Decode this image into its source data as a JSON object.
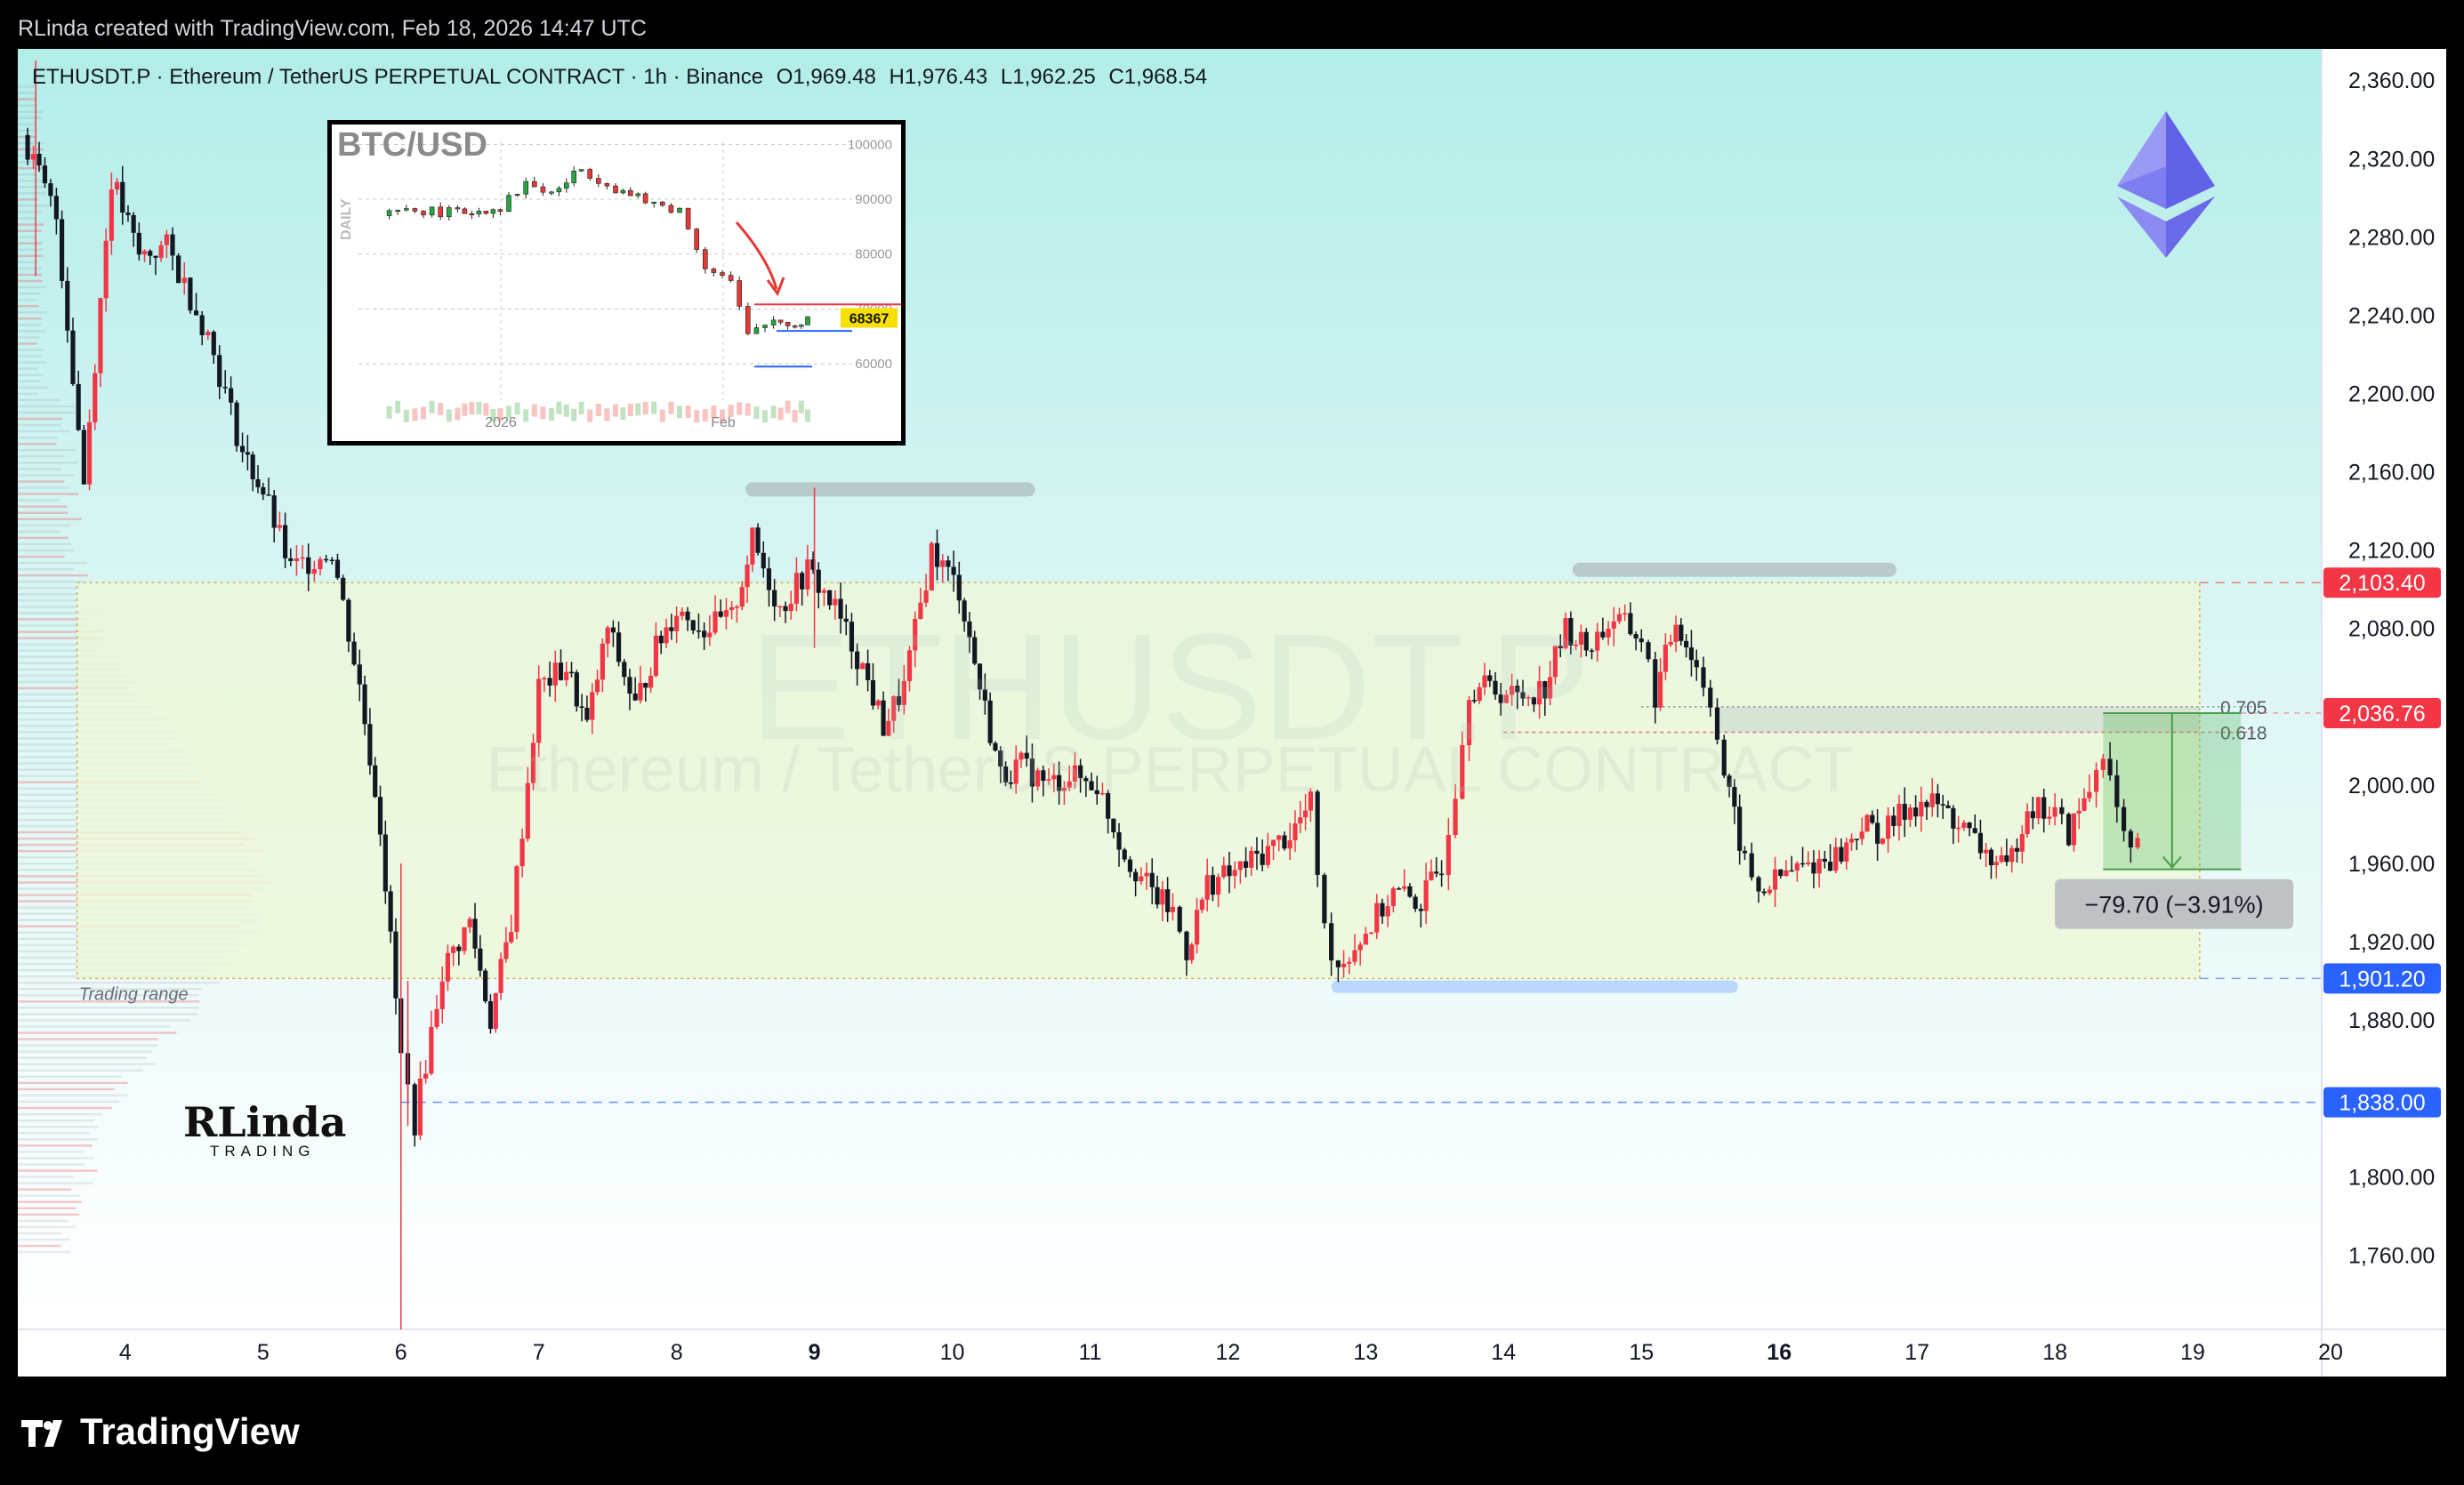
{
  "header": {
    "credit": "RLinda created with TradingView.com, Feb 18, 2026 14:47 UTC"
  },
  "legend": {
    "symbol": "ETHUSDT.P · Ethereum / TetherUS PERPETUAL CONTRACT · 1h · Binance",
    "open": "O1,969.48",
    "high": "H1,976.43",
    "low": "L1,962.25",
    "close": "C1,968.54"
  },
  "watermark": {
    "symbol": "ETHUSDT.P",
    "description": "Ethereum / TetherUS PERPETUAL CONTRACT"
  },
  "footer": {
    "brand": "TradingView"
  },
  "annotations": {
    "trading_range_label": "Trading range",
    "measure_label": "−79.70 (−3.91%)",
    "fib_705": "0.705",
    "fib_618": "0.618",
    "author_logo": "RLinda",
    "author_logo_sub": "TRADING"
  },
  "price_tags": [
    {
      "value": 2103.4,
      "label": "2,103.40",
      "color": "#f23645"
    },
    {
      "value": 2036.76,
      "label": "2,036.76",
      "color": "#f23645"
    },
    {
      "value": 1901.2,
      "label": "1,901.20",
      "color": "#2962ff"
    },
    {
      "value": 1838.0,
      "label": "1,838.00",
      "color": "#2962ff"
    }
  ],
  "colors": {
    "up": "#f23645",
    "down": "#131722",
    "accent_blue": "#2962ff",
    "range_fill": "#eef8d8",
    "target_fill": "#4caf50"
  },
  "chart_data": [
    {
      "type": "candlestick",
      "title": "",
      "x_ticks": [
        {
          "day": 4,
          "label": "4",
          "bold": false
        },
        {
          "day": 5,
          "label": "5",
          "bold": false
        },
        {
          "day": 6,
          "label": "6",
          "bold": false
        },
        {
          "day": 7,
          "label": "7",
          "bold": false
        },
        {
          "day": 8,
          "label": "8",
          "bold": false
        },
        {
          "day": 9,
          "label": "9",
          "bold": true
        },
        {
          "day": 10,
          "label": "10",
          "bold": false
        },
        {
          "day": 11,
          "label": "11",
          "bold": false
        },
        {
          "day": 12,
          "label": "12",
          "bold": false
        },
        {
          "day": 13,
          "label": "13",
          "bold": false
        },
        {
          "day": 14,
          "label": "14",
          "bold": false
        },
        {
          "day": 15,
          "label": "15",
          "bold": false
        },
        {
          "day": 16,
          "label": "16",
          "bold": true
        },
        {
          "day": 17,
          "label": "17",
          "bold": false
        },
        {
          "day": 18,
          "label": "18",
          "bold": false
        },
        {
          "day": 19,
          "label": "19",
          "bold": false
        },
        {
          "day": 20,
          "label": "20",
          "bold": false
        }
      ],
      "y_ticks": [
        2360,
        2320,
        2280,
        2240,
        2200,
        2160,
        2120,
        2080,
        2040,
        2000,
        1960,
        1920,
        1880,
        1840,
        1800,
        1760
      ],
      "y_tick_labels": [
        "2,360.00",
        "2,320.00",
        "2,280.00",
        "2,240.00",
        "2,200.00",
        "2,160.00",
        "2,120.00",
        "2,080.00",
        "2,040.00",
        "2,000.00",
        "1,960.00",
        "1,920.00",
        "1,880.00",
        "1,840.00",
        "1,800.00",
        "1,760.00"
      ],
      "ylim": [
        1722,
        2376
      ],
      "xlim": [
        3.22,
        20.0
      ],
      "trading_range": {
        "x_start": 3.65,
        "x_end": 19.05,
        "y_low": 1901.2,
        "y_high": 2103.4
      },
      "fib_zone": {
        "x_start": 15.55,
        "x_end": 19.05,
        "y_low": 2027,
        "y_high": 2040
      },
      "target_box": {
        "x_start": 18.35,
        "x_end": 19.35,
        "y_high": 2036.76,
        "y_low": 1957
      },
      "support_1838": {
        "x_start": 6.0,
        "x_end": 19.05,
        "y": 1838
      },
      "resistance_marks": [
        {
          "x_start": 8.5,
          "x_end": 10.6,
          "y": 2151
        },
        {
          "x_start": 14.5,
          "x_end": 16.85,
          "y": 2110
        }
      ],
      "support_mark": {
        "x_start": 12.75,
        "x_end": 15.7,
        "y": 1897
      },
      "key_points": [
        {
          "x": 3.25,
          "y": 2332
        },
        {
          "x": 3.5,
          "y": 2290
        },
        {
          "x": 3.7,
          "y": 2155
        },
        {
          "x": 3.9,
          "y": 2310
        },
        {
          "x": 4.1,
          "y": 2270
        },
        {
          "x": 4.3,
          "y": 2275
        },
        {
          "x": 4.6,
          "y": 2230
        },
        {
          "x": 4.85,
          "y": 2170
        },
        {
          "x": 5.0,
          "y": 2150
        },
        {
          "x": 5.2,
          "y": 2110
        },
        {
          "x": 5.5,
          "y": 2120
        },
        {
          "x": 5.7,
          "y": 2050
        },
        {
          "x": 5.85,
          "y": 1980
        },
        {
          "x": 6.0,
          "y": 1860
        },
        {
          "x": 6.1,
          "y": 1828
        },
        {
          "x": 6.3,
          "y": 1905
        },
        {
          "x": 6.5,
          "y": 1930
        },
        {
          "x": 6.65,
          "y": 1880
        },
        {
          "x": 6.8,
          "y": 1930
        },
        {
          "x": 7.0,
          "y": 2050
        },
        {
          "x": 7.2,
          "y": 2060
        },
        {
          "x": 7.35,
          "y": 2030
        },
        {
          "x": 7.5,
          "y": 2080
        },
        {
          "x": 7.7,
          "y": 2040
        },
        {
          "x": 7.85,
          "y": 2070
        },
        {
          "x": 8.0,
          "y": 2090
        },
        {
          "x": 8.2,
          "y": 2080
        },
        {
          "x": 8.4,
          "y": 2085
        },
        {
          "x": 8.55,
          "y": 2125
        },
        {
          "x": 8.75,
          "y": 2090
        },
        {
          "x": 8.95,
          "y": 2110
        },
        {
          "x": 9.15,
          "y": 2090
        },
        {
          "x": 9.35,
          "y": 2060
        },
        {
          "x": 9.5,
          "y": 2030
        },
        {
          "x": 9.65,
          "y": 2050
        },
        {
          "x": 9.85,
          "y": 2120
        },
        {
          "x": 10.05,
          "y": 2100
        },
        {
          "x": 10.2,
          "y": 2050
        },
        {
          "x": 10.35,
          "y": 2005
        },
        {
          "x": 10.5,
          "y": 2010
        },
        {
          "x": 10.7,
          "y": 2000
        },
        {
          "x": 10.85,
          "y": 2005
        },
        {
          "x": 11.05,
          "y": 2000
        },
        {
          "x": 11.25,
          "y": 1965
        },
        {
          "x": 11.45,
          "y": 1945
        },
        {
          "x": 11.6,
          "y": 1935
        },
        {
          "x": 11.7,
          "y": 1915
        },
        {
          "x": 11.85,
          "y": 1950
        },
        {
          "x": 12.05,
          "y": 1955
        },
        {
          "x": 12.25,
          "y": 1965
        },
        {
          "x": 12.45,
          "y": 1975
        },
        {
          "x": 12.6,
          "y": 1990
        },
        {
          "x": 12.7,
          "y": 1925
        },
        {
          "x": 12.8,
          "y": 1908
        },
        {
          "x": 13.0,
          "y": 1925
        },
        {
          "x": 13.2,
          "y": 1945
        },
        {
          "x": 13.4,
          "y": 1940
        },
        {
          "x": 13.55,
          "y": 1960
        },
        {
          "x": 13.65,
          "y": 2000
        },
        {
          "x": 13.75,
          "y": 2050
        },
        {
          "x": 13.9,
          "y": 2050
        },
        {
          "x": 14.1,
          "y": 2045
        },
        {
          "x": 14.3,
          "y": 2050
        },
        {
          "x": 14.45,
          "y": 2080
        },
        {
          "x": 14.6,
          "y": 2070
        },
        {
          "x": 14.8,
          "y": 2085
        },
        {
          "x": 15.0,
          "y": 2075
        },
        {
          "x": 15.1,
          "y": 2045
        },
        {
          "x": 15.25,
          "y": 2085
        },
        {
          "x": 15.4,
          "y": 2060
        },
        {
          "x": 15.5,
          "y": 2045
        },
        {
          "x": 15.6,
          "y": 2005
        },
        {
          "x": 15.75,
          "y": 1960
        },
        {
          "x": 15.85,
          "y": 1945
        },
        {
          "x": 16.05,
          "y": 1955
        },
        {
          "x": 16.25,
          "y": 1960
        },
        {
          "x": 16.45,
          "y": 1965
        },
        {
          "x": 16.6,
          "y": 1980
        },
        {
          "x": 16.75,
          "y": 1975
        },
        {
          "x": 16.95,
          "y": 1990
        },
        {
          "x": 17.15,
          "y": 1990
        },
        {
          "x": 17.3,
          "y": 1980
        },
        {
          "x": 17.5,
          "y": 1965
        },
        {
          "x": 17.65,
          "y": 1955
        },
        {
          "x": 17.8,
          "y": 1990
        },
        {
          "x": 18.0,
          "y": 1985
        },
        {
          "x": 18.1,
          "y": 1975
        },
        {
          "x": 18.25,
          "y": 1998
        },
        {
          "x": 18.35,
          "y": 2020
        },
        {
          "x": 18.45,
          "y": 1985
        },
        {
          "x": 18.55,
          "y": 1962
        },
        {
          "x": 18.6,
          "y": 1968
        }
      ]
    },
    {
      "type": "candlestick",
      "title": "BTC/USD",
      "side_label": "DAILY",
      "x_tick_labels": [
        "2026",
        "Feb"
      ],
      "y_ticks": [
        100000,
        90000,
        80000,
        70000,
        60000
      ],
      "y_tick_labels": [
        "100000",
        "90000",
        "80000",
        "70000",
        "60000"
      ],
      "last_price_label": "68367",
      "key_points": [
        {
          "t": 0,
          "y": 87000
        },
        {
          "t": 0.08,
          "y": 88000
        },
        {
          "t": 0.18,
          "y": 87500
        },
        {
          "t": 0.28,
          "y": 88500
        },
        {
          "t": 0.34,
          "y": 93000
        },
        {
          "t": 0.4,
          "y": 91000
        },
        {
          "t": 0.47,
          "y": 95500
        },
        {
          "t": 0.55,
          "y": 92000
        },
        {
          "t": 0.62,
          "y": 89500
        },
        {
          "t": 0.7,
          "y": 88000
        },
        {
          "t": 0.76,
          "y": 78000
        },
        {
          "t": 0.82,
          "y": 75000
        },
        {
          "t": 0.86,
          "y": 65000
        },
        {
          "t": 0.92,
          "y": 68000
        },
        {
          "t": 0.97,
          "y": 67000
        },
        {
          "t": 1.0,
          "y": 68367
        }
      ]
    }
  ]
}
